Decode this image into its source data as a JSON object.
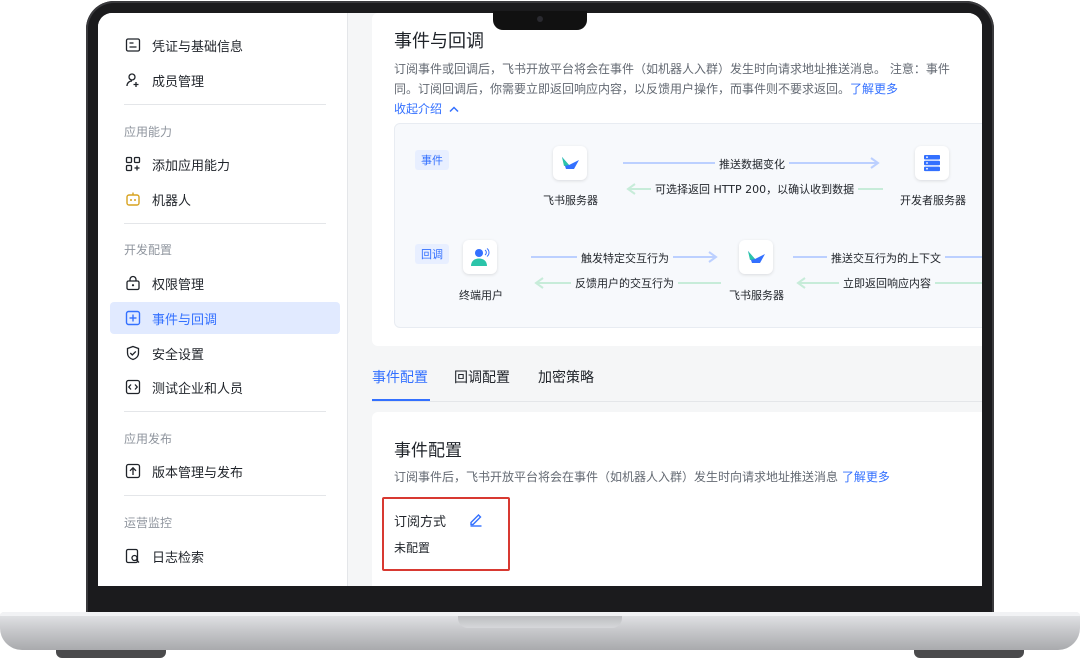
{
  "sidebar": {
    "items": [
      {
        "label": "凭证与基础信息",
        "icon": "id-card-icon"
      },
      {
        "label": "成员管理",
        "icon": "user-plus-icon"
      },
      {
        "label": "添加应用能力",
        "icon": "apps-add-icon"
      },
      {
        "label": "机器人",
        "icon": "robot-icon"
      },
      {
        "label": "权限管理",
        "icon": "lock-icon"
      },
      {
        "label": "事件与回调",
        "icon": "event-callback-icon"
      },
      {
        "label": "安全设置",
        "icon": "shield-icon"
      },
      {
        "label": "测试企业和人员",
        "icon": "code-test-icon"
      },
      {
        "label": "版本管理与发布",
        "icon": "upload-icon"
      },
      {
        "label": "日志检索",
        "icon": "log-search-icon"
      }
    ],
    "groups": [
      "应用能力",
      "开发配置",
      "应用发布",
      "运营监控"
    ],
    "active_index": 5
  },
  "intro": {
    "title": "事件与回调",
    "desc_line1": "订阅事件或回调后，飞书开放平台将会在事件（如机器人入群）发生时向请求地址推送消息。 注意：事件",
    "desc_line2": "同。订阅回调后，你需要立即返回响应内容，以反馈用户操作，而事件则不要求返回。",
    "learn_more": "了解更多",
    "collapse": "收起介绍"
  },
  "diagram": {
    "event": {
      "tag": "事件",
      "left_node": "飞书服务器",
      "right_node": "开发者服务器",
      "forward": "推送数据变化",
      "back": "可选择返回 HTTP 200，以确认收到数据"
    },
    "callback": {
      "tag": "回调",
      "left_node": "终端用户",
      "mid_node": "飞书服务器",
      "forward1": "触发特定交互行为",
      "back1": "反馈用户的交互行为",
      "forward2": "推送交互行为的上下文",
      "back2": "立即返回响应内容"
    }
  },
  "tabs": [
    "事件配置",
    "回调配置",
    "加密策略"
  ],
  "event_config": {
    "title": "事件配置",
    "desc": "订阅事件后，飞书开放平台将会在事件（如机器人入群）发生时向请求地址推送消息",
    "learn_more": "了解更多",
    "subscribe_label": "订阅方式",
    "subscribe_value": "未配置"
  },
  "colors": {
    "accent": "#3370ff",
    "highlight_border": "#d83931"
  }
}
